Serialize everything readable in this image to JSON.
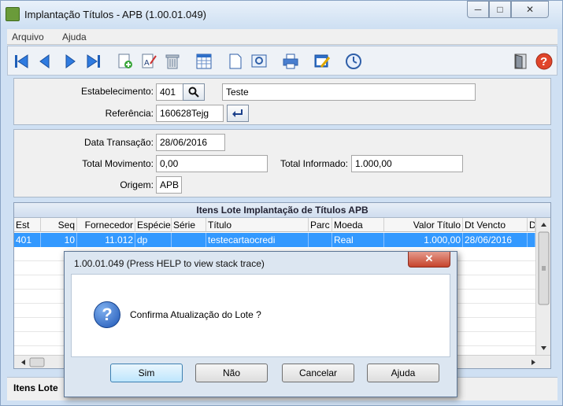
{
  "window": {
    "title": "Implantação Títulos - APB (1.00.01.049)",
    "minimize": "─",
    "maximize": "□",
    "close": "✕"
  },
  "menu": [
    "Arquivo",
    "Ajuda"
  ],
  "toolbar_icons": [
    "first-record-icon",
    "previous-record-icon",
    "next-record-icon",
    "last-record-icon",
    "add-icon",
    "edit-icon",
    "delete-icon",
    "grid-icon",
    "document-icon",
    "preview-icon",
    "print-icon",
    "edit-form-icon",
    "clock-icon",
    "exit-door-icon",
    "help-icon"
  ],
  "header": {
    "estabelecimento_label": "Estabelecimento:",
    "estabelecimento_value": "401",
    "estabelecimento_desc": "Teste",
    "referencia_label": "Referência:",
    "referencia_value": "160628Tejg"
  },
  "details": {
    "data_transacao_label": "Data Transação:",
    "data_transacao_value": "28/06/2016",
    "total_movimento_label": "Total  Movimento:",
    "total_movimento_value": "0,00",
    "total_informado_label": "Total Informado:",
    "total_informado_value": "1.000,00",
    "origem_label": "Origem:",
    "origem_value": "APB"
  },
  "grid": {
    "title": "Itens Lote Implantação de Títulos APB",
    "columns": [
      "Est",
      "Seq",
      "Fornecedor",
      "Espécie",
      "Série",
      "Título",
      "Parc",
      "Moeda",
      "Valor Título",
      "Dt Vencto",
      "D"
    ],
    "rows": [
      [
        "401",
        "10",
        "11.012",
        "dp",
        "",
        "testecartaocredi",
        "",
        "Real",
        "1.000,00",
        "28/06/2016",
        ""
      ]
    ]
  },
  "status": {
    "label": "Itens Lote"
  },
  "dialog": {
    "title": "1.00.01.049 (Press HELP to view stack trace)",
    "message": "Confirma Atualização do Lote ?",
    "buttons": [
      "Sim",
      "Não",
      "Cancelar",
      "Ajuda"
    ],
    "close_label": "✕"
  }
}
